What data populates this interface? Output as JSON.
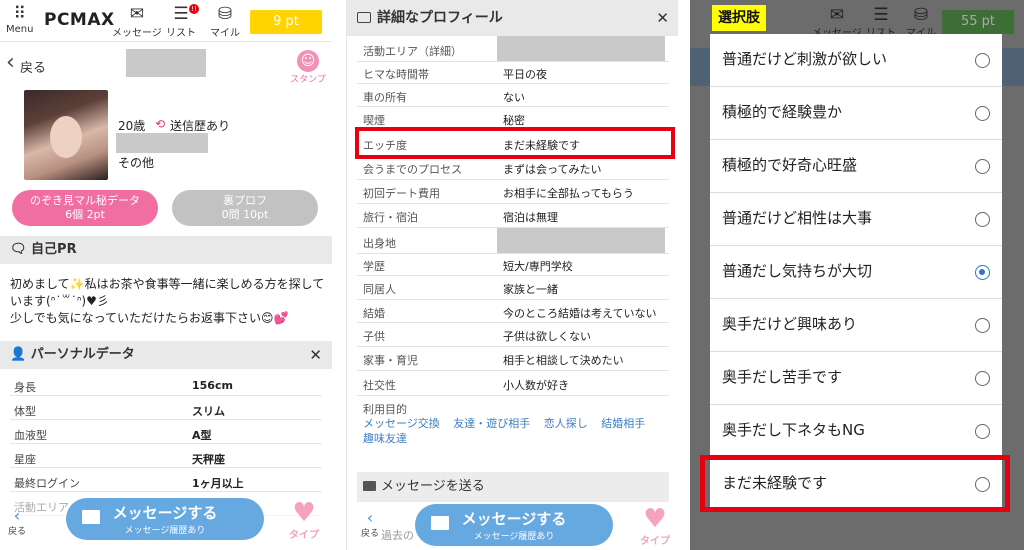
{
  "p1": {
    "nav": {
      "menu_label": "Menu",
      "logo": "PCMAX",
      "message_label": "メッセージ",
      "list_label": "リスト",
      "list_badge": "!!",
      "mile_label": "マイル",
      "points": "9 pt"
    },
    "back_label": "戻る",
    "stamp_label": "スタンプ",
    "age": "20歳",
    "sent_history": "送信歴あり",
    "other": "その他",
    "secret_btn": {
      "line1": "のぞき見マル秘データ",
      "line2": "6個 2pt"
    },
    "ura_btn": {
      "line1": "裏プロフ",
      "line2": "0問 10pt"
    },
    "pr_title": "自己PR",
    "pr_text": "初めまして✨私はお茶や食事等一緒に楽しめる方を探しています(ᐢ˙꒳˙ᐢ)♥彡\n少しでも気になっていただけたらお返事下さい😊💕",
    "personal_title": "パーソナルデータ",
    "personal": [
      {
        "k": "身長",
        "v": "156cm"
      },
      {
        "k": "体型",
        "v": "スリム"
      },
      {
        "k": "血液型",
        "v": "A型"
      },
      {
        "k": "星座",
        "v": "天秤座"
      },
      {
        "k": "最終ログイン",
        "v": "1ヶ月以上"
      },
      {
        "k": "活動エリア",
        "v": ""
      }
    ],
    "bottom": {
      "back_label": "戻る",
      "msg_big": "メッセージする",
      "msg_small": "メッセージ履歴あり",
      "type_label": "タイプ"
    }
  },
  "p2": {
    "title": "詳細なプロフィール",
    "rows": [
      {
        "k": "活動エリア（詳細）",
        "v": ""
      },
      {
        "k": "ヒマな時間帯",
        "v": "平日の夜"
      },
      {
        "k": "車の所有",
        "v": "ない"
      },
      {
        "k": "喫煙",
        "v": "秘密"
      },
      {
        "k": "エッチ度",
        "v": "まだ未経験です"
      },
      {
        "k": "会うまでのプロセス",
        "v": "まずは会ってみたい"
      },
      {
        "k": "初回デート費用",
        "v": "お相手に全部払ってもらう"
      },
      {
        "k": "旅行・宿泊",
        "v": "宿泊は無理"
      },
      {
        "k": "出身地",
        "v": ""
      },
      {
        "k": "学歴",
        "v": "短大/専門学校"
      },
      {
        "k": "同居人",
        "v": "家族と一緒"
      },
      {
        "k": "結婚",
        "v": "今のところ結婚は考えていない"
      },
      {
        "k": "子供",
        "v": "子供は欲しくない"
      },
      {
        "k": "家事・育児",
        "v": "相手と相談して決めたい"
      },
      {
        "k": "社交性",
        "v": "小人数が好き"
      }
    ],
    "purpose_label": "利用目的",
    "purposes": [
      "メッセージ交換",
      "友達・遊び相手",
      "恋人探し",
      "結婚相手",
      "趣味友達"
    ],
    "send_msg_title": "メッセージを送る",
    "past_text": "過去の",
    "bottom": {
      "back_label": "戻る",
      "msg_big": "メッセージする",
      "msg_small": "メッセージ履歴あり",
      "type_label": "タイプ"
    }
  },
  "p3": {
    "title": "選択肢",
    "points": "55 pt",
    "message_label": "メッセージ",
    "list_label": "リスト",
    "mile_label": "マイル",
    "options": [
      {
        "label": "普通だけど刺激が欲しい",
        "selected": false
      },
      {
        "label": "積極的で経験豊か",
        "selected": false
      },
      {
        "label": "積極的で好奇心旺盛",
        "selected": false
      },
      {
        "label": "普通だけど相性は大事",
        "selected": false
      },
      {
        "label": "普通だし気持ちが大切",
        "selected": true
      },
      {
        "label": "奥手だけど興味あり",
        "selected": false
      },
      {
        "label": "奥手だし苦手です",
        "selected": false
      },
      {
        "label": "奥手だし下ネタもNG",
        "selected": false
      },
      {
        "label": "まだ未経験です",
        "selected": false
      }
    ]
  },
  "colors": {
    "accent_pink": "#f06ea0",
    "accent_blue": "#66a8e0",
    "highlight_red": "#e60012",
    "points_yellow": "#ffd400",
    "title_yellow": "#ffff00"
  }
}
